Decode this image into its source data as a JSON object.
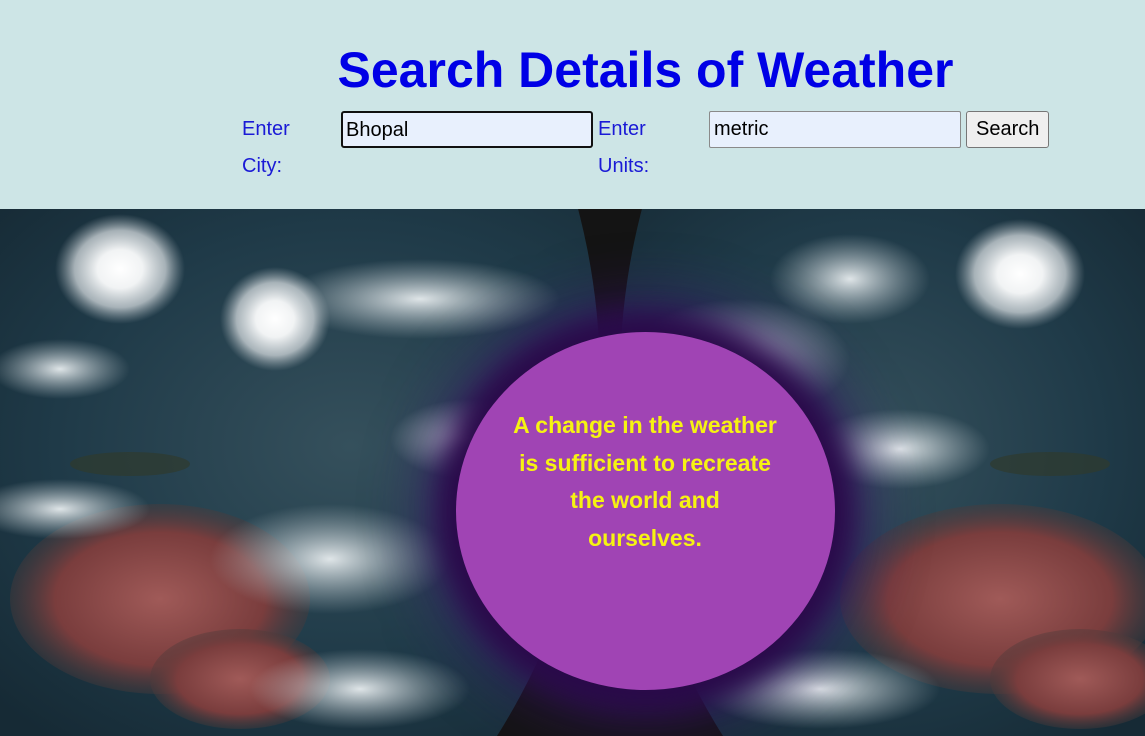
{
  "page": {
    "title": "Search Details of Weather"
  },
  "search_form": {
    "city_label": "Enter City:",
    "city_value": "Bhopal",
    "units_label": "Enter Units:",
    "units_value": "metric",
    "search_button": "Search"
  },
  "hero": {
    "background": "satellite-earth-image",
    "quote": "A change in the weather is sufficient to recreate the world and ourselves."
  },
  "colors": {
    "header_bg": "#cde5e6",
    "title": "#0000e6",
    "label": "#1a1ad6",
    "circle": "#a044b4",
    "quote_text": "#f6f312"
  }
}
